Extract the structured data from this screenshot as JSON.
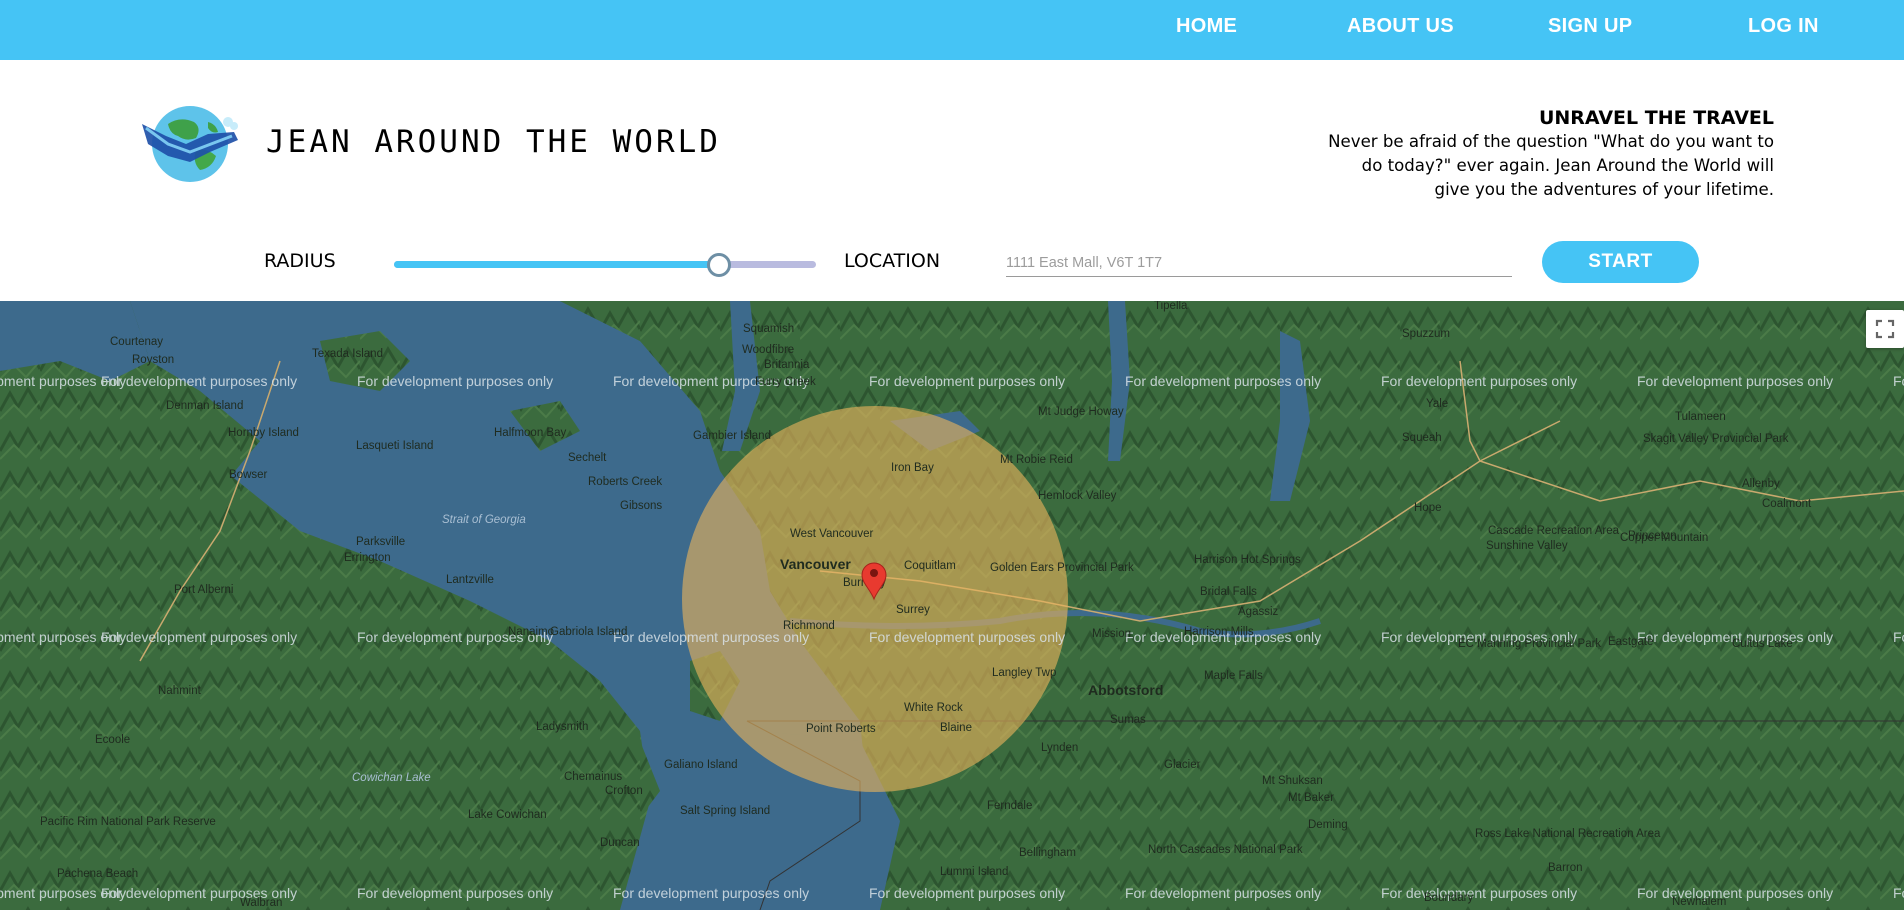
{
  "nav": {
    "items": [
      "HOME",
      "ABOUT US",
      "SIGN UP",
      "LOG IN"
    ]
  },
  "header": {
    "brand": "JEAN AROUND THE WORLD",
    "logo_icon": "globe-with-ribbon-icon",
    "tagline_title": "UNRAVEL THE TRAVEL",
    "tagline_lines": [
      "Never be afraid of the question \"What do you want to",
      "do today?\" ever again. Jean Around the World will",
      "give you the adventures of your lifetime."
    ]
  },
  "controls": {
    "radius_label": "RADIUS",
    "radius_value_fraction": 0.77,
    "location_label": "LOCATION",
    "location_placeholder": "1111 East Mall, V6T 1T7",
    "start_label": "START"
  },
  "map": {
    "watermark": "For development purposes only",
    "fullscreen_icon": "fullscreen-icon",
    "marker_icon": "map-pin-icon",
    "places": [
      "Courtenay",
      "Royston",
      "Texada Island",
      "Denman Island",
      "Hornby Island",
      "Lasqueti Island",
      "Bowser",
      "Parksville",
      "Errington",
      "Port Alberni",
      "Lantzville",
      "Nanaimo",
      "Gabriola Island",
      "Nahmint",
      "Ecoole",
      "Ladysmith",
      "Chemainus",
      "Lake Cowichan",
      "Cowichan Lake",
      "Duncan",
      "Crofton",
      "Salt Spring Island",
      "Galiano Island",
      "Pacific Rim National Park Reserve",
      "Pachena Beach",
      "Walbran",
      "Squamish",
      "Woodfibre",
      "Britannia",
      "Furry Creek",
      "Halfmoon Bay",
      "Sechelt",
      "Gambier Island",
      "Roberts Creek",
      "Gibsons",
      "Strait of Georgia",
      "Iron Bay",
      "West Vancouver",
      "Vancouver",
      "Burnaby",
      "Coquitlam",
      "Richmond",
      "Surrey",
      "Golden Ears Provincial Park",
      "Langley Twp",
      "White Rock",
      "Point Roberts",
      "Blaine",
      "Ferndale",
      "Lummi Island",
      "Bellingham",
      "Lynden",
      "Sumas",
      "Abbotsford",
      "Mission",
      "Harrison Mills",
      "Agassiz",
      "Bridal Falls",
      "Harrison Hot Springs",
      "Hemlock Valley",
      "Mt Judge Howay",
      "Mt Robie Reid",
      "Tipella",
      "Spuzzum",
      "Yale",
      "Squeah",
      "Hope",
      "Sunshine Valley",
      "Cascade Recreation Area",
      "Copper Mountain",
      "Princeton",
      "Allenby",
      "Coalmont",
      "Tulameen",
      "Skagit Valley Provincial Park",
      "EC Manning Provincial Park",
      "Eastgate",
      "Cultus Lake",
      "Maple Falls",
      "Glacier",
      "Mt Shuksan",
      "Mt Baker",
      "Deming",
      "North Cascades National Park",
      "Ross Lake National Recreation Area",
      "Barron",
      "Newhalem",
      "Boundary"
    ]
  }
}
